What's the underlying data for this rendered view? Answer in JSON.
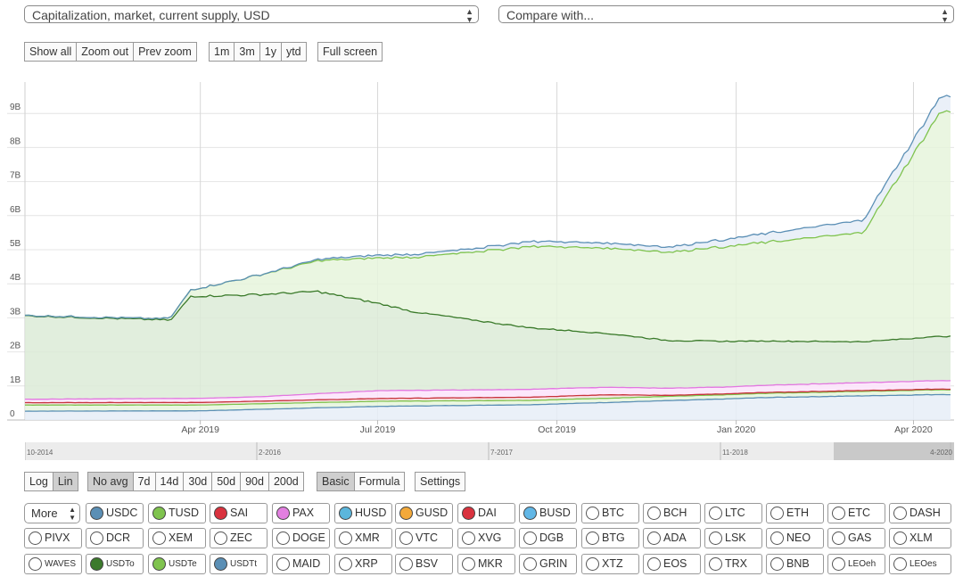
{
  "selects": {
    "metric": "Capitalization, market, current supply, USD",
    "compare": "Compare with..."
  },
  "zoom_buttons": [
    "Show all",
    "Zoom out",
    "Prev zoom"
  ],
  "range_buttons": [
    "1m",
    "3m",
    "1y",
    "ytd"
  ],
  "fullscreen": "Full screen",
  "scale_buttons": [
    "Log",
    "Lin"
  ],
  "scale_active": "Lin",
  "avg_buttons": [
    "No avg",
    "7d",
    "14d",
    "30d",
    "50d",
    "90d",
    "200d"
  ],
  "avg_active": "No avg",
  "mode_buttons": [
    "Basic",
    "Formula"
  ],
  "mode_active": "Basic",
  "settings": "Settings",
  "more_label": "More",
  "timeline_labels": [
    "10-2014",
    "2-2016",
    "7-2017",
    "11-2018",
    "4-2020"
  ],
  "chart_data": {
    "type": "area",
    "stacked": true,
    "x_ticks": [
      "Apr 2019",
      "Jul 2019",
      "Oct 2019",
      "Jan 2020",
      "Apr 2020"
    ],
    "y_ticks": [
      "0",
      "1B",
      "2B",
      "3B",
      "4B",
      "5B",
      "6B",
      "7B",
      "8B",
      "9B"
    ],
    "ylim": [
      0,
      9500000000
    ],
    "x_range": [
      "2019-01-01",
      "2020-04-20"
    ],
    "grid": true,
    "series": [
      {
        "name": "USDC",
        "color": "#5b8fb5",
        "fill": "#e6edf7",
        "values": [
          [
            0,
            260000000.0
          ],
          [
            90,
            270000000.0
          ],
          [
            180,
            400000000.0
          ],
          [
            260,
            450000000.0
          ],
          [
            360,
            620000000.0
          ],
          [
            380,
            660000000.0
          ],
          [
            470,
            750000000.0
          ]
        ]
      },
      {
        "name": "TUSD",
        "color": "#7fc34e",
        "fill": "#e6f5dc",
        "values": [
          [
            0,
            180000000.0
          ],
          [
            90,
            170000000.0
          ],
          [
            180,
            150000000.0
          ],
          [
            260,
            130000000.0
          ],
          [
            360,
            120000000.0
          ],
          [
            470,
            140000000.0
          ]
        ]
      },
      {
        "name": "SAI",
        "color": "#c8323c",
        "fill": "#f5dfe1",
        "values": [
          [
            0,
            70000000.0
          ],
          [
            180,
            80000000.0
          ],
          [
            300,
            100000000.0
          ],
          [
            330,
            30000000.0
          ],
          [
            470,
            20000000.0
          ]
        ]
      },
      {
        "name": "PAX",
        "color": "#e277e0",
        "fill": "#fbe3fa",
        "values": [
          [
            0,
            100000000.0
          ],
          [
            120,
            130000000.0
          ],
          [
            180,
            230000000.0
          ],
          [
            270,
            230000000.0
          ],
          [
            360,
            200000000.0
          ],
          [
            470,
            250000000.0
          ]
        ]
      },
      {
        "name": "USDTo",
        "color": "#3a7a2a",
        "fill": "#dcebd7",
        "values": [
          [
            0,
            2450000000.0
          ],
          [
            75,
            2300000000.0
          ],
          [
            85,
            3000000000.0
          ],
          [
            150,
            3000000000.0
          ],
          [
            200,
            2300000000.0
          ],
          [
            260,
            1800000000.0
          ],
          [
            330,
            1400000000.0
          ],
          [
            430,
            1200000000.0
          ],
          [
            470,
            1300000000.0
          ]
        ]
      },
      {
        "name": "USDTe",
        "color": "#7fc34e",
        "fill": "#e6f5dc",
        "values": [
          [
            0,
            10000000.0
          ],
          [
            70,
            30000000.0
          ],
          [
            100,
            350000000.0
          ],
          [
            150,
            900000000.0
          ],
          [
            200,
            1600000000.0
          ],
          [
            260,
            2400000000.0
          ],
          [
            330,
            2600000000.0
          ],
          [
            430,
            3200000000.0
          ],
          [
            470,
            6600000000.0
          ]
        ]
      },
      {
        "name": "USDTt",
        "color": "#5b8fb5",
        "fill": "#e6edf7",
        "values": [
          [
            0,
            0
          ],
          [
            120,
            0
          ],
          [
            180,
            80000000.0
          ],
          [
            230,
            100000000.0
          ],
          [
            260,
            150000000.0
          ],
          [
            330,
            150000000.0
          ],
          [
            470,
            450000000.0
          ]
        ]
      }
    ]
  },
  "legend": [
    {
      "label": "USDC",
      "color": "#5b8fb5",
      "active": true
    },
    {
      "label": "TUSD",
      "color": "#7fc34e",
      "active": true
    },
    {
      "label": "SAI",
      "color": "#d9323e",
      "active": true
    },
    {
      "label": "PAX",
      "color": "#e27fe0",
      "active": true
    },
    {
      "label": "HUSD",
      "color": "#5bb6dc",
      "active": true
    },
    {
      "label": "GUSD",
      "color": "#f3a93a",
      "active": true
    },
    {
      "label": "DAI",
      "color": "#d9323e",
      "active": true
    },
    {
      "label": "BUSD",
      "color": "#62b7e6",
      "active": true
    },
    {
      "label": "BTC",
      "active": false
    },
    {
      "label": "BCH",
      "active": false
    },
    {
      "label": "LTC",
      "active": false
    },
    {
      "label": "ETH",
      "active": false
    },
    {
      "label": "ETC",
      "active": false
    },
    {
      "label": "DASH",
      "active": false
    },
    {
      "label": "PIVX",
      "active": false
    },
    {
      "label": "DCR",
      "active": false
    },
    {
      "label": "XEM",
      "active": false
    },
    {
      "label": "ZEC",
      "active": false
    },
    {
      "label": "DOGE",
      "active": false
    },
    {
      "label": "XMR",
      "active": false
    },
    {
      "label": "VTC",
      "active": false
    },
    {
      "label": "XVG",
      "active": false
    },
    {
      "label": "DGB",
      "active": false
    },
    {
      "label": "BTG",
      "active": false
    },
    {
      "label": "ADA",
      "active": false
    },
    {
      "label": "LSK",
      "active": false
    },
    {
      "label": "NEO",
      "active": false
    },
    {
      "label": "GAS",
      "active": false
    },
    {
      "label": "XLM",
      "active": false
    },
    {
      "label": "WAVES",
      "active": false,
      "small": true
    },
    {
      "label": "USDTo",
      "color": "#3c7a2c",
      "active": true,
      "small": true
    },
    {
      "label": "USDTe",
      "color": "#7fc34e",
      "active": true,
      "small": true
    },
    {
      "label": "USDTt",
      "color": "#5b8fb5",
      "active": true,
      "small": true
    },
    {
      "label": "MAID",
      "active": false
    },
    {
      "label": "XRP",
      "active": false
    },
    {
      "label": "BSV",
      "active": false
    },
    {
      "label": "MKR",
      "active": false
    },
    {
      "label": "GRIN",
      "active": false
    },
    {
      "label": "XTZ",
      "active": false
    },
    {
      "label": "EOS",
      "active": false
    },
    {
      "label": "TRX",
      "active": false
    },
    {
      "label": "BNB",
      "active": false
    },
    {
      "label": "LEOeh",
      "active": false,
      "small": true
    },
    {
      "label": "LEOes",
      "active": false,
      "small": true
    }
  ]
}
